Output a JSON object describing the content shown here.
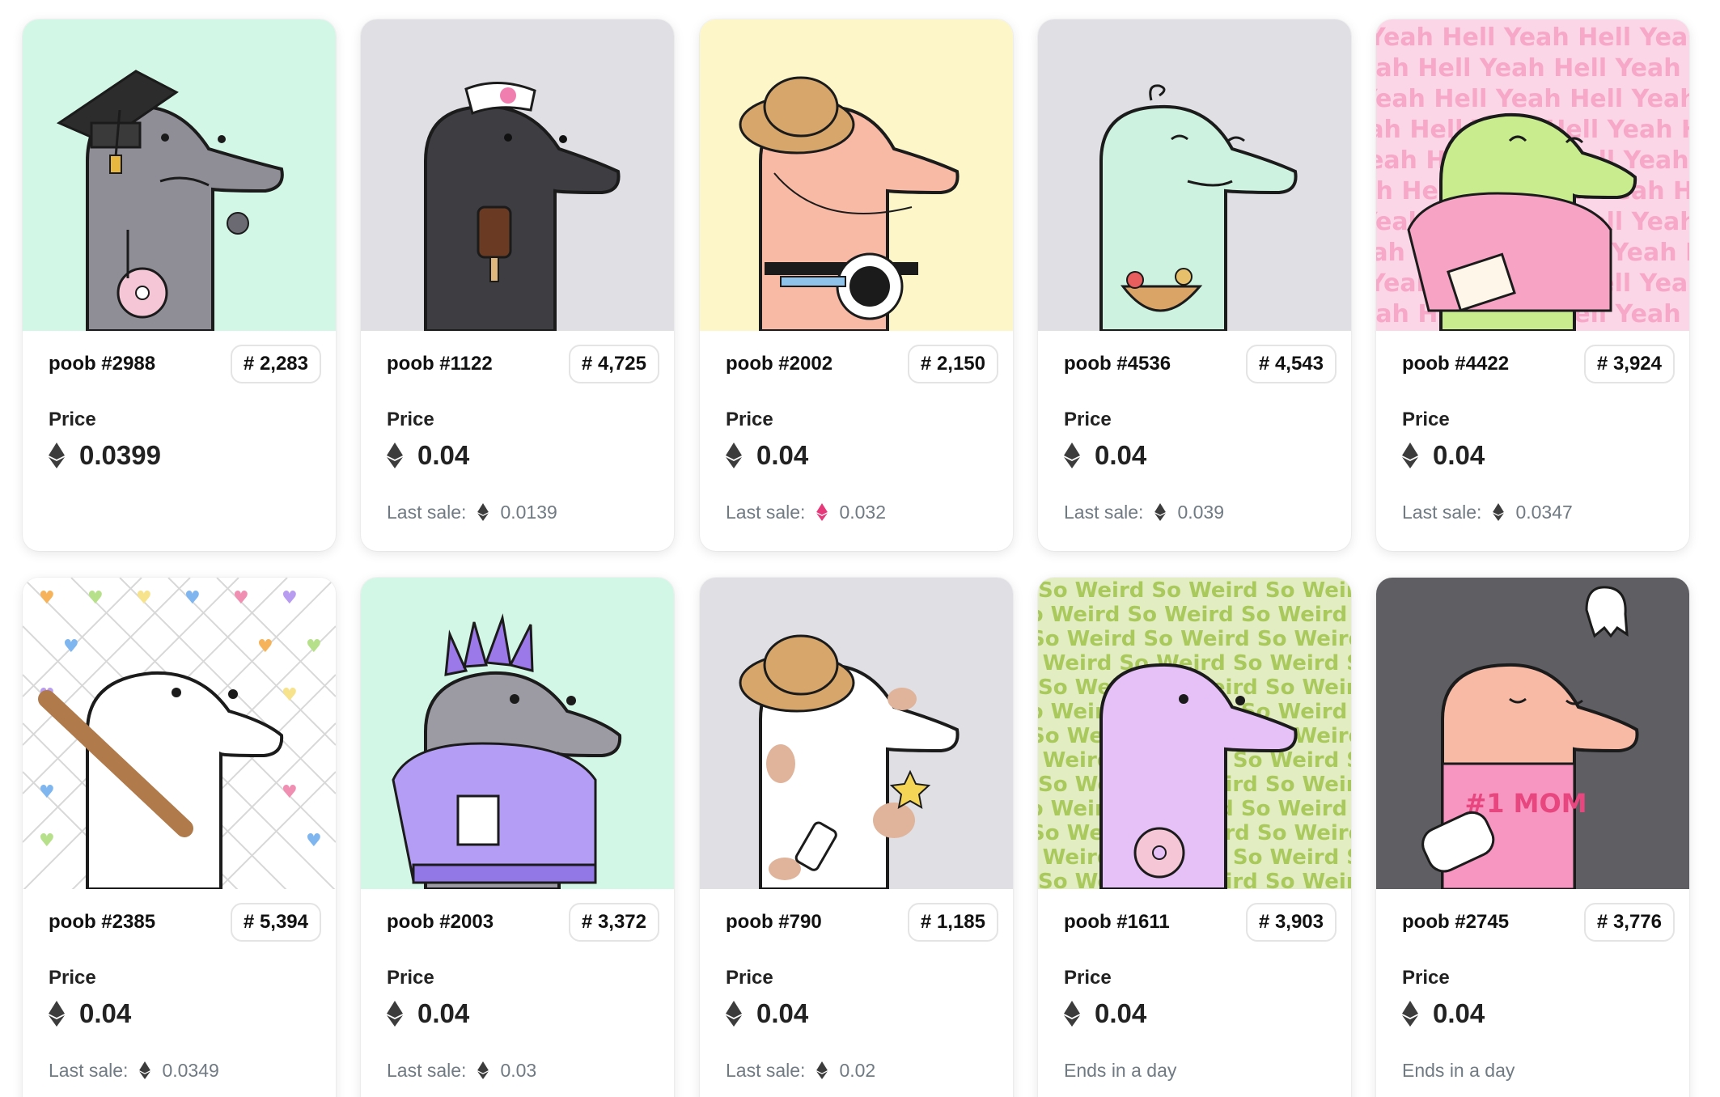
{
  "cards": [
    {
      "name": "poob #2988",
      "rank": "# 2,283",
      "price_label": "Price",
      "price": "0.0399",
      "footer_label": "",
      "footer_value": "",
      "bg": "#d3f7e7"
    },
    {
      "name": "poob #1122",
      "rank": "# 4,725",
      "price_label": "Price",
      "price": "0.04",
      "footer_label": "Last sale:",
      "footer_value": "0.0139",
      "bg": "#e0dfe4"
    },
    {
      "name": "poob #2002",
      "rank": "# 2,150",
      "price_label": "Price",
      "price": "0.04",
      "footer_label": "Last sale:",
      "footer_value": "0.032",
      "footer_eth": "pink",
      "bg": "#fdf6c8"
    },
    {
      "name": "poob #4536",
      "rank": "# 4,543",
      "price_label": "Price",
      "price": "0.04",
      "footer_label": "Last sale:",
      "footer_value": "0.039",
      "bg": "#e0dfe4"
    },
    {
      "name": "poob #4422",
      "rank": "# 3,924",
      "price_label": "Price",
      "price": "0.04",
      "footer_label": "Last sale:",
      "footer_value": "0.0347",
      "bg": "#fbd6e6"
    },
    {
      "name": "poob #2385",
      "rank": "# 5,394",
      "price_label": "Price",
      "price": "0.04",
      "footer_label": "Last sale:",
      "footer_value": "0.0349",
      "bg": "#ffffff"
    },
    {
      "name": "poob #2003",
      "rank": "# 3,372",
      "price_label": "Price",
      "price": "0.04",
      "footer_label": "Last sale:",
      "footer_value": "0.03",
      "bg": "#d3f7e7"
    },
    {
      "name": "poob #790",
      "rank": "# 1,185",
      "price_label": "Price",
      "price": "0.04",
      "footer_label": "Last sale:",
      "footer_value": "0.02",
      "bg": "#e0dfe4"
    },
    {
      "name": "poob #1611",
      "rank": "# 3,903",
      "price_label": "Price",
      "price": "0.04",
      "footer_label": "Ends in a day",
      "footer_value": "",
      "bg": "#e2edc2"
    },
    {
      "name": "poob #2745",
      "rank": "# 3,776",
      "price_label": "Price",
      "price": "0.04",
      "footer_label": "Ends in a day",
      "footer_value": "",
      "bg": "#5f5e63"
    }
  ],
  "patterns": {
    "yeah_hell": "Yeah Hell Yeah Hell Yeah Hell Yeah",
    "so_weird": "So Weird So Weird So Weird So Weird",
    "mom": "#1 MOM"
  },
  "colors": {
    "eth": "#3c3c3d",
    "eth_pink": "#e5397a",
    "muted": "#707a83"
  }
}
